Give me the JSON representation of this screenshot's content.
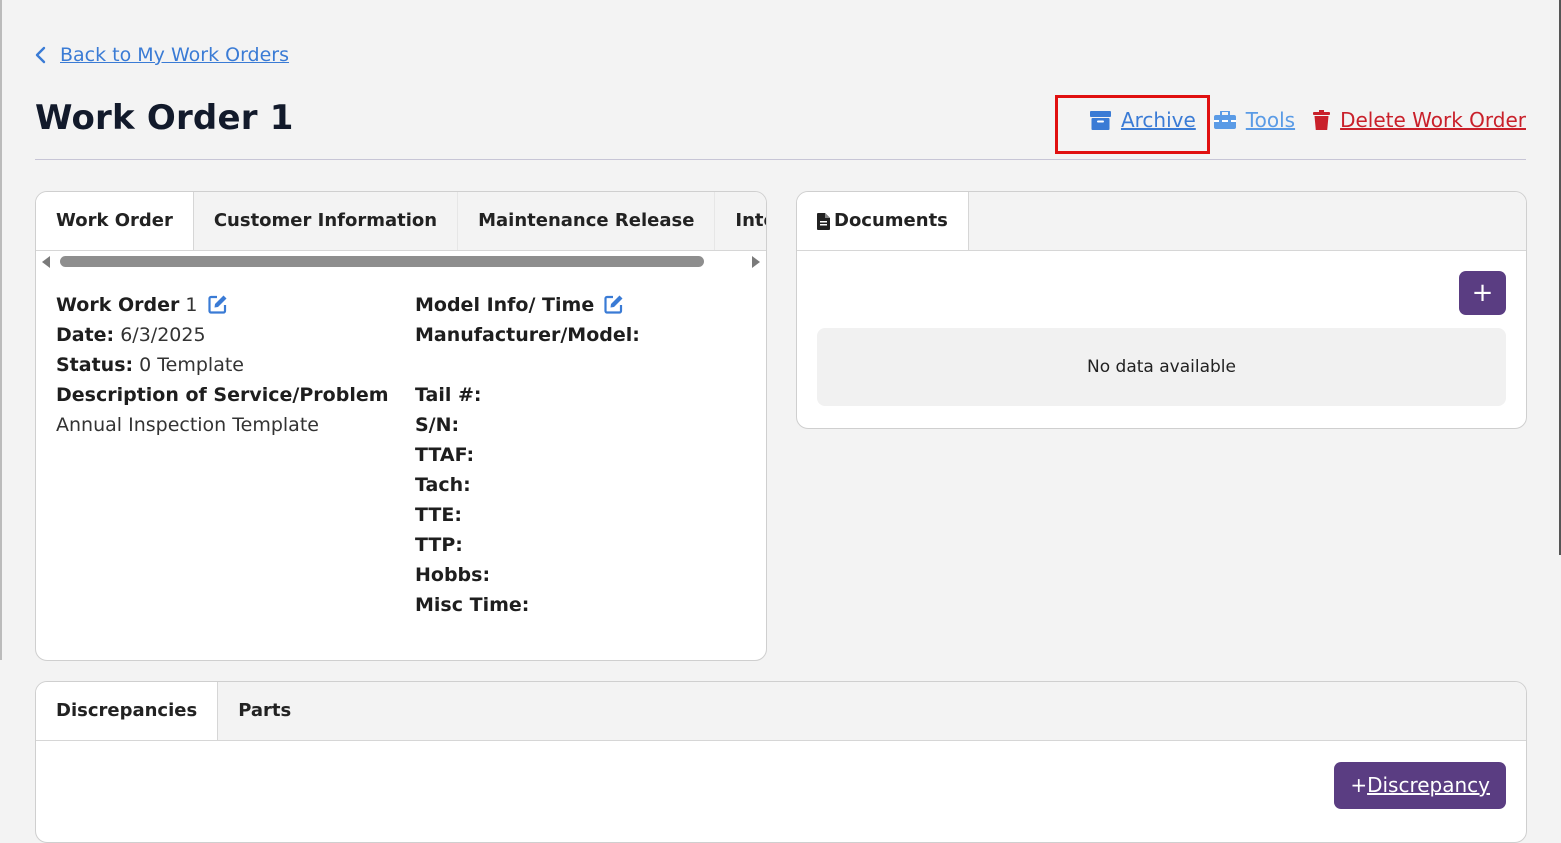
{
  "nav": {
    "back_label": "Back to My Work Orders"
  },
  "page": {
    "title": "Work Order 1"
  },
  "actions": {
    "archive_label": "Archive",
    "tools_label": "Tools",
    "delete_label": "Delete Work Order"
  },
  "colors": {
    "link": "#3a7bd5",
    "danger": "#c9202a",
    "primary_button": "#5a3d82",
    "highlight": "#e01010"
  },
  "work_order_card": {
    "tabs": [
      "Work Order",
      "Customer Information",
      "Maintenance Release",
      "Internal Not"
    ],
    "left": {
      "wo_label": "Work Order",
      "wo_value": "1",
      "date_label": "Date:",
      "date_value": "6/3/2025",
      "status_label": "Status:",
      "status_value": "0 Template",
      "desc_label": "Description of Service/Problem",
      "desc_value": "Annual Inspection Template"
    },
    "right": {
      "model_heading": "Model Info/ Time",
      "manufacturer_label": "Manufacturer/Model:",
      "tail_label": "Tail #:",
      "sn_label": "S/N:",
      "ttaf_label": "TTAF:",
      "tach_label": "Tach:",
      "tte_label": "TTE:",
      "ttp_label": "TTP:",
      "hobbs_label": "Hobbs:",
      "misc_label": "Misc Time:"
    }
  },
  "documents_card": {
    "tab_label": "Documents",
    "add_symbol": "+",
    "empty_text": "No data available"
  },
  "bottom_card": {
    "tabs": [
      "Discrepancies",
      "Parts"
    ],
    "add_symbol": "+",
    "add_label": "Discrepancy"
  }
}
